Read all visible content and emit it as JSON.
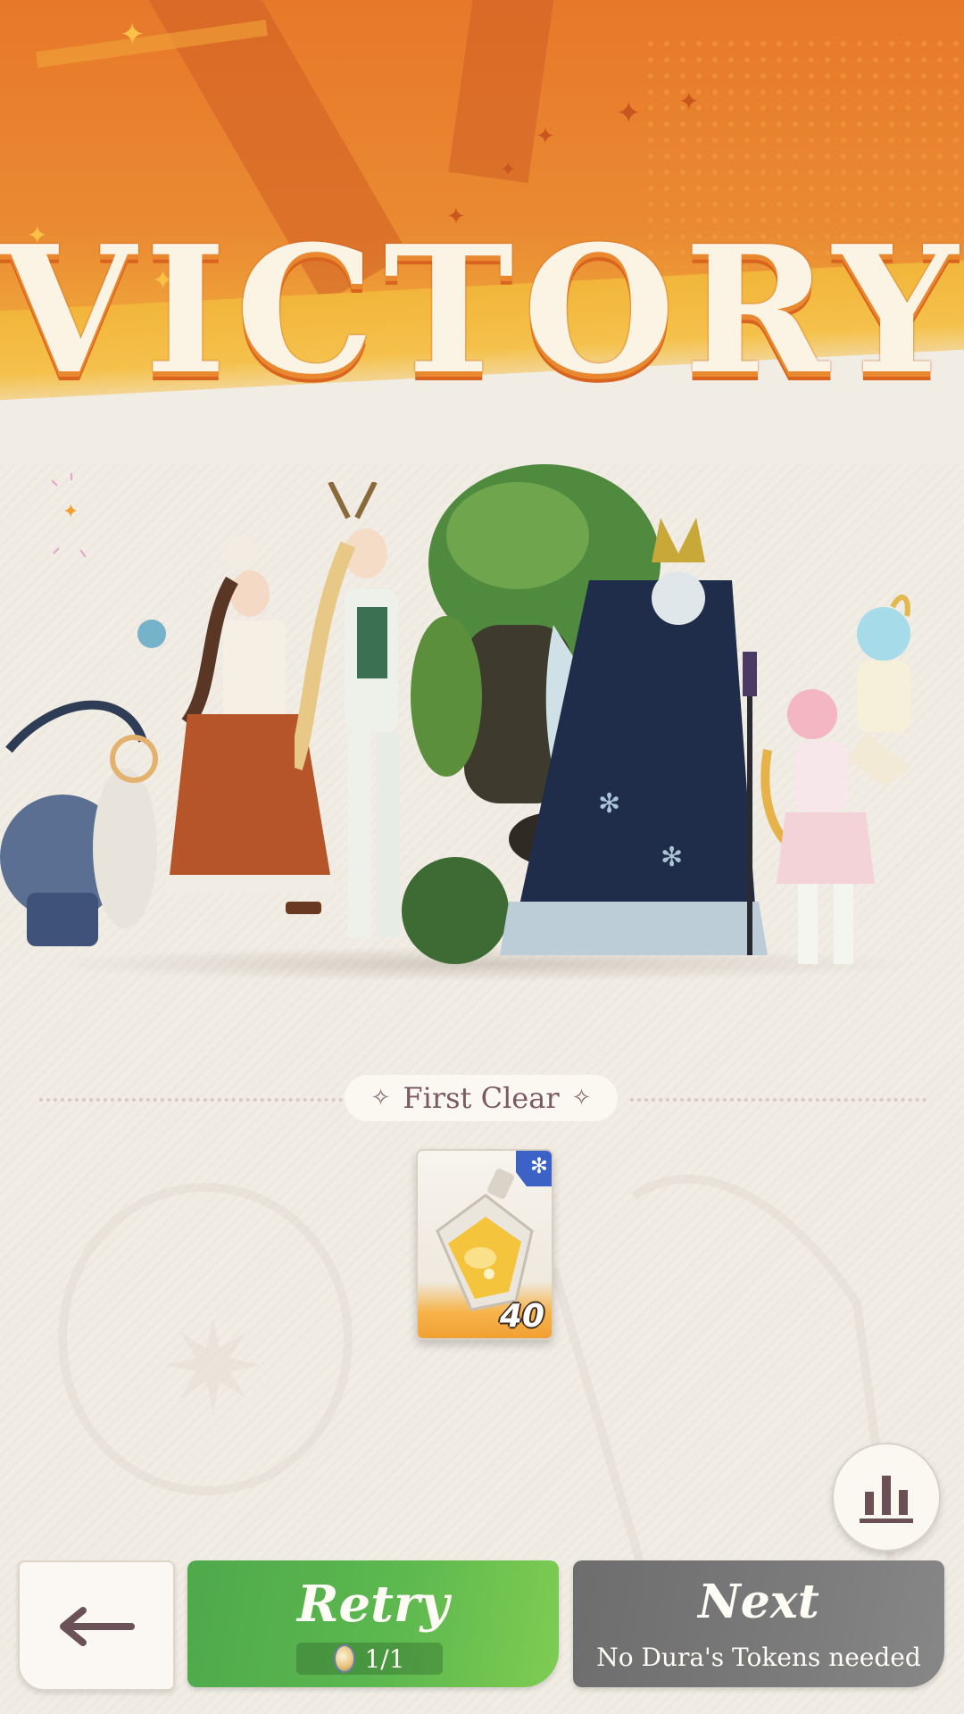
{
  "header": {
    "title": "VICTORY"
  },
  "party": {
    "members": [
      "ram-mount-icon",
      "noble-lady-icon",
      "deer-elf-icon",
      "forest-golem-icon",
      "frost-king-icon",
      "pink-angel-icon",
      "blue-sprite-icon"
    ]
  },
  "rewards": {
    "section_label": "First Clear",
    "items": [
      {
        "icon": "potion-bottle-icon",
        "badge_icon": "snowflake-icon",
        "quantity": "40"
      }
    ]
  },
  "actions": {
    "back_icon": "back-arrow-icon",
    "stats_icon": "bar-chart-icon",
    "retry_label": "Retry",
    "retry_uses": "1/1",
    "next_label": "Next",
    "next_sub": "No Dura's Tokens needed"
  },
  "colors": {
    "banner_orange": "#e7782a",
    "banner_gold": "#f2b53b",
    "retry_green": "#5cb84f",
    "next_gray": "#7b7b7b",
    "cream_bg": "#f1ede5"
  }
}
